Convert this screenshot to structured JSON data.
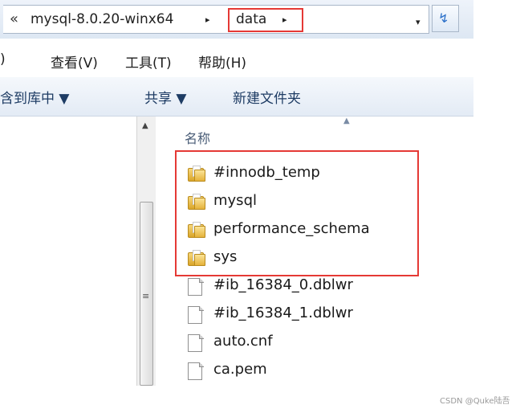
{
  "address_bar": {
    "overflow_chevron": "«",
    "segments": [
      "mysql-8.0.20-winx64",
      "data"
    ],
    "separator": "▸",
    "dropdown": "▾",
    "highlight_color": "#e53935"
  },
  "menu": {
    "items": [
      ")",
      "查看(V)",
      "工具(T)",
      "帮助(H)"
    ]
  },
  "toolbar": {
    "items": [
      "含到库中 ▼",
      "共享 ▼",
      "新建文件夹"
    ]
  },
  "file_list": {
    "column_header": "名称",
    "sort_indicator": "▲",
    "items": [
      {
        "name": "#innodb_temp",
        "type": "folder"
      },
      {
        "name": "mysql",
        "type": "folder"
      },
      {
        "name": "performance_schema",
        "type": "folder"
      },
      {
        "name": "sys",
        "type": "folder"
      },
      {
        "name": "#ib_16384_0.dblwr",
        "type": "file"
      },
      {
        "name": "#ib_16384_1.dblwr",
        "type": "file"
      },
      {
        "name": "auto.cnf",
        "type": "file"
      },
      {
        "name": "ca.pem",
        "type": "file"
      }
    ]
  },
  "scrollbar": {
    "up_arrow": "▲",
    "grip": "≡"
  },
  "refresh": {
    "icon": "refresh-icon",
    "glyph": "↯"
  },
  "watermark": "CSDN @Quke陆吾"
}
